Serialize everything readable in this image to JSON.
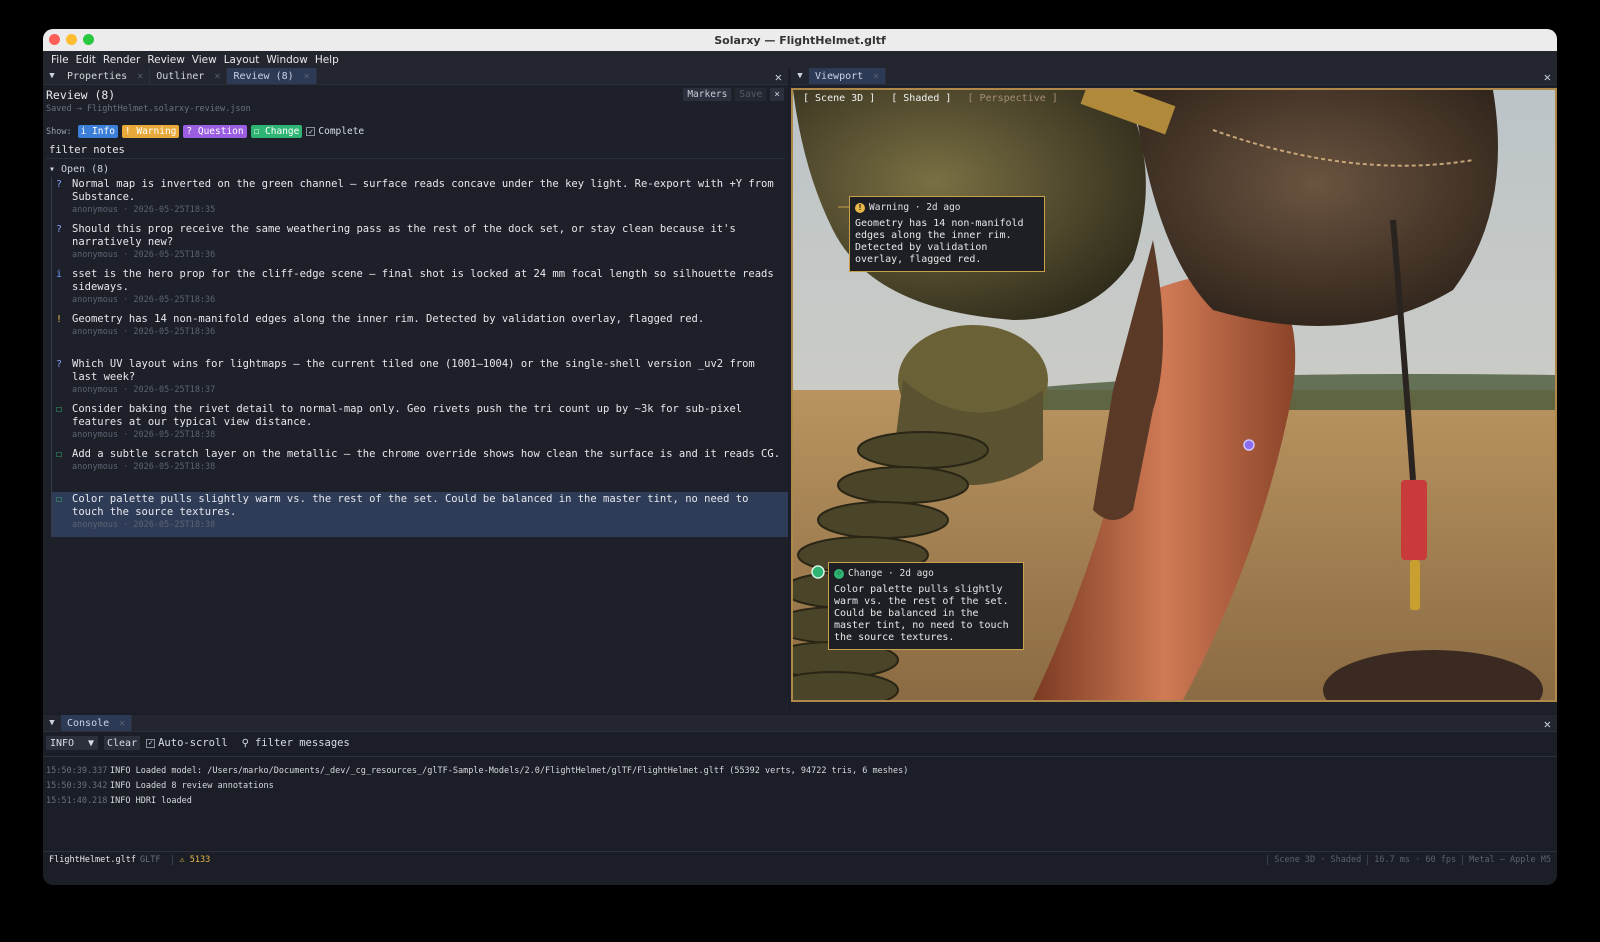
{
  "window": {
    "title": "Solarxy — FlightHelmet.gltf",
    "traffic_colors": [
      "#fe5f57",
      "#febc2e",
      "#28c840"
    ]
  },
  "menu": [
    "File",
    "Edit",
    "Render",
    "Review",
    "View",
    "Layout",
    "Window",
    "Help"
  ],
  "left_tabs": {
    "items": [
      "Properties",
      "Outliner",
      "Review (8)"
    ],
    "active": 2
  },
  "review": {
    "title": "Review (8)",
    "saved": "Saved → FlightHelmet.solarxy-review.json",
    "markers_label": "Markers",
    "save_label": "Save",
    "close_label": "×",
    "show_label": "Show:",
    "filters": [
      {
        "label": "i Info",
        "color": "#3b7fd8"
      },
      {
        "label": "! Warning",
        "color": "#e8a93a"
      },
      {
        "label": "? Question",
        "color": "#9a5fe0"
      },
      {
        "label": "☐ Change",
        "color": "#2fb573"
      }
    ],
    "complete_label": "Complete",
    "filter_placeholder": "filter notes",
    "group_label": "▾ Open (8)",
    "notes": [
      {
        "icon": "?",
        "color": "#8aa2ff",
        "text": "Normal map is inverted on the green channel — surface reads concave under the key light. Re-export with +Y from Substance.",
        "meta": "anonymous · 2026-05-25T18:35"
      },
      {
        "icon": "?",
        "color": "#8aa2ff",
        "text": "Should this prop receive the same weathering pass as the rest of the dock set, or stay clean because it's narratively new?",
        "meta": "anonymous · 2026-05-25T18:36"
      },
      {
        "icon": "i",
        "color": "#6fa0ff",
        "text": "sset is the hero prop for the cliff-edge scene — final shot is locked at 24 mm focal length so silhouette reads sideways.",
        "meta": "anonymous · 2026-05-25T18:36"
      },
      {
        "icon": "!",
        "color": "#e8b84a",
        "text": "Geometry has 14 non-manifold edges along the inner rim. Detected by validation overlay, flagged red.",
        "meta": "anonymous · 2026-05-25T18:36"
      },
      {
        "icon": "?",
        "color": "#8aa2ff",
        "text": "Which UV layout wins for lightmaps — the current tiled one (1001–1004) or the single-shell version _uv2 from last week?",
        "meta": "anonymous · 2026-05-25T18:37"
      },
      {
        "icon": "☐",
        "color": "#3fc27f",
        "text": "Consider baking the rivet detail to normal-map only. Geo rivets push the tri count up by ~3k for sub-pixel features at our typical view distance.",
        "meta": "anonymous · 2026-05-25T18:38"
      },
      {
        "icon": "☐",
        "color": "#3fc27f",
        "text": "Add a subtle scratch layer on the metallic — the chrome override shows how clean the surface is and it reads CG.",
        "meta": "anonymous · 2026-05-25T18:38"
      },
      {
        "icon": "☐",
        "color": "#3fc27f",
        "text": "Color palette pulls slightly warm vs. the rest of the set. Could be balanced in the master tint, no need to touch the source textures.",
        "meta": "anonymous · 2026-05-25T18:38",
        "selected": true
      }
    ]
  },
  "viewport": {
    "tab": "Viewport",
    "bar": [
      "[ Scene 3D ]",
      "[ Shaded ]",
      "[ Perspective ]"
    ],
    "ann_warning": {
      "header": "Warning · 2d ago",
      "text": "Geometry has 14 non-manifold edges along the inner rim. Detected by validation overlay, flagged red."
    },
    "ann_change": {
      "header": "Change · 2d ago",
      "text": "Color palette pulls slightly warm vs. the rest of the set. Could be balanced in the master tint, no need to touch the source textures."
    }
  },
  "console": {
    "tab": "Console",
    "level": "INFO",
    "clear_label": "Clear",
    "autoscroll_label": "Auto-scroll",
    "filter_placeholder": "filter messages",
    "lines": [
      {
        "ts": "15:50:39.337",
        "msg": "INFO Loaded model: /Users/marko/Documents/_dev/_cg_resources_/glTF-Sample-Models/2.0/FlightHelmet/glTF/FlightHelmet.gltf (55392 verts, 94722 tris, 6 meshes)"
      },
      {
        "ts": "15:50:39.342",
        "msg": "INFO Loaded 8 review annotations"
      },
      {
        "ts": "15:51:40.218",
        "msg": "INFO HDRI loaded"
      }
    ]
  },
  "status": {
    "file": "FlightHelmet.gltf",
    "format": "GLTF",
    "warnings": "⚠ 5133",
    "mode": "Scene 3D · Shaded",
    "perf": "16.7 ms · 60 fps",
    "gpu": "Metal — Apple M5"
  }
}
